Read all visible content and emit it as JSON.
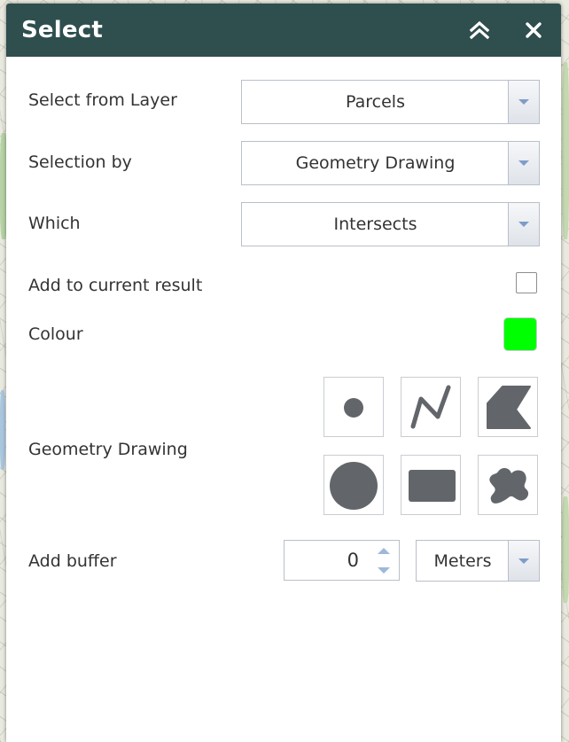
{
  "window": {
    "title": "Select"
  },
  "titlebar": {
    "collapse_icon": "double-chevron-up-icon",
    "close_icon": "close-icon",
    "background": "#2f4e4e"
  },
  "form": {
    "layer": {
      "label": "Select from Layer",
      "value": "Parcels"
    },
    "selection_by": {
      "label": "Selection by",
      "value": "Geometry Drawing"
    },
    "which": {
      "label": "Which",
      "value": "Intersects"
    },
    "add_to_current": {
      "label": "Add to current result",
      "checked": false
    },
    "colour": {
      "label": "Colour",
      "value": "#00ff00"
    },
    "geometry": {
      "label": "Geometry Drawing",
      "tools": [
        "point-icon",
        "polyline-icon",
        "polygon-icon",
        "circle-icon",
        "rectangle-icon",
        "freehand-polygon-icon"
      ]
    },
    "buffer": {
      "label": "Add buffer",
      "value": "0",
      "unit": "Meters"
    }
  }
}
